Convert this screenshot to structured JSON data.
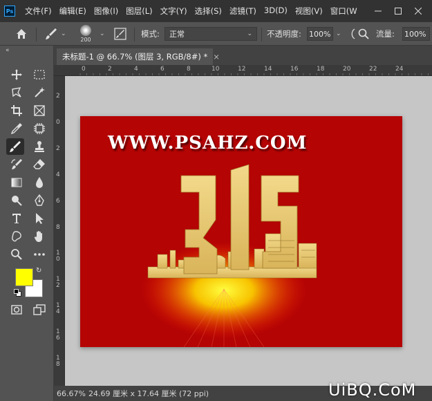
{
  "app": {
    "logo_text": "Ps"
  },
  "menu": [
    "文件(F)",
    "编辑(E)",
    "图像(I)",
    "图层(L)",
    "文字(Y)",
    "选择(S)",
    "滤镜(T)",
    "3D(D)",
    "视图(V)",
    "窗口(W"
  ],
  "options": {
    "brush_size": "200",
    "mode_label": "模式:",
    "mode_value": "正常",
    "opacity_label": "不透明度:",
    "opacity_value": "100%",
    "flow_label": "流量:",
    "flow_value": "100%"
  },
  "document": {
    "tab_title": "未标题-1 @ 66.7% (图层 3, RGB/8#) *",
    "close_symbol": "×",
    "zoom": "66.67%",
    "info": "24.69 厘米 x 17.64 厘米 (72 ppi)"
  },
  "ruler_top": [
    "0",
    "2",
    "4",
    "6",
    "8",
    "10",
    "12",
    "14",
    "16",
    "18",
    "20",
    "22",
    "24"
  ],
  "ruler_left": [
    "2",
    "0",
    "2",
    "4",
    "6",
    "8",
    "1 0",
    "1 2",
    "1 4",
    "1 6",
    "1 8"
  ],
  "artwork": {
    "site_text": "WWW.PSAHZ.COM",
    "big_number": "315"
  },
  "colors": {
    "foreground": "#ffff00",
    "background": "#ffffff",
    "canvas_red": "#b40404",
    "gold": "#e8c66a"
  },
  "watermark": "UiBQ.CoM"
}
